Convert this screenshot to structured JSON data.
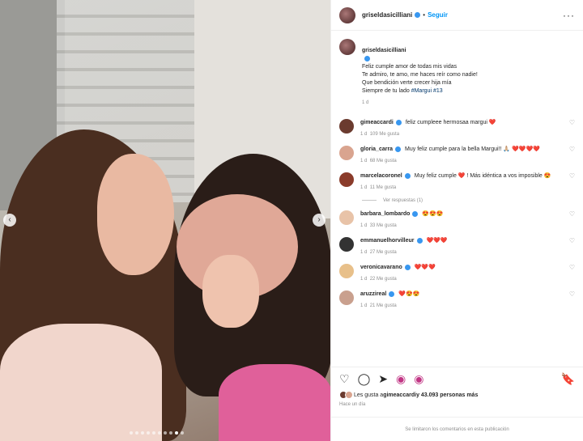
{
  "post": {
    "author": "griseldasicilliani",
    "follow_label": "Seguir",
    "caption_lines": "Feliz cumple amor de todas mis vidas\nTe admiro, te amo, me haces reír como nadie!\nQue bendición verte crecer hija mía\nSiempre de tu lado ",
    "caption_tags": "#Margui #13",
    "caption_age": "1 d",
    "liked_by_prefix": "Les gusta a ",
    "liked_by_user": "gimeaccardi",
    "liked_by_suffix": " y 43.093 personas más",
    "time_ago": "Hace un día",
    "comments_limited": "Se limitaron los comentarios en esta publicación"
  },
  "comments": [
    {
      "user": "gimeaccardi",
      "text": "feliz cumpleee hermosaa margui ❤️",
      "age": "1 d",
      "likes": "109 Me gusta",
      "avatar_color": "#6b3b2f"
    },
    {
      "user": "gloria_carra",
      "text": "Muy feliz cumple para la bella Margui!! 🙏🏼 ❤️❤️❤️❤️",
      "age": "1 d",
      "likes": "68 Me gusta",
      "avatar_color": "#d9a48f"
    },
    {
      "user": "marcelacoronel",
      "text": "Muy feliz cumple ❤️ ! Más idéntica a vos imposible 😍",
      "age": "1 d",
      "likes": "11 Me gusta",
      "avatar_color": "#8a3b2a"
    },
    {
      "user": "barbara_lombardo",
      "text": "😍😍😍",
      "age": "1 d",
      "likes": "33 Me gusta",
      "avatar_color": "#e8c3a8"
    },
    {
      "user": "emmanuelhorvilleur",
      "text": "❤️❤️❤️",
      "age": "1 d",
      "likes": "27 Me gusta",
      "avatar_color": "#333333"
    },
    {
      "user": "veronicavarano",
      "text": "❤️❤️❤️",
      "age": "1 d",
      "likes": "22 Me gusta",
      "avatar_color": "#e8c08a"
    },
    {
      "user": "aruzzireal",
      "text": "❤️😍😍",
      "age": "1 d",
      "likes": "21 Me gusta",
      "avatar_color": "#c9a08e"
    }
  ],
  "replies_label": "Ver respuestas (1)",
  "icons": {
    "heart": "heart-icon",
    "comment": "comment-icon",
    "share": "share-icon",
    "bookmark": "bookmark-icon"
  },
  "colors": {
    "accent": "#0095f6",
    "verified": "#3897f0"
  }
}
